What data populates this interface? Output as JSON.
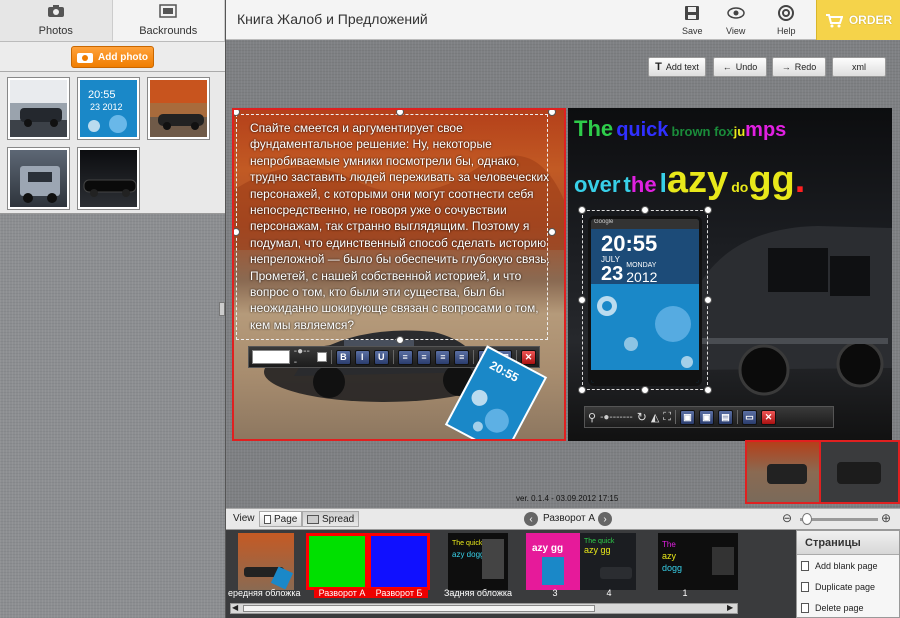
{
  "left_panel": {
    "tabs": [
      {
        "label": "Photos",
        "icon": "camera-icon"
      },
      {
        "label": "Backrounds",
        "icon": "background-icon"
      }
    ],
    "add_photo_label": "Add photo",
    "thumbnails": [
      "silver-car-photo",
      "blue-phone-photo",
      "canyon-car-photo",
      "rolls-royce-photo",
      "black-car-photo"
    ]
  },
  "header": {
    "title": "Книга Жалоб и Предложений",
    "save_label": "Save",
    "view_label": "View",
    "help_label": "Help",
    "order_label": "ORDER"
  },
  "toolbar": {
    "add_text": "Add text",
    "undo": "Undo",
    "redo": "Redo",
    "xml": "xml"
  },
  "left_page": {
    "text": "Спайте смеется и аргументирует свое фундаментальное решение: Ну, некоторые непробиваемые умники посмотрели бы, однако, трудно заставить людей переживать за человеческих персонажей, с которыми они могут соотнести себя непосредственно, не говоря уже о сочувствии персонажам, так странно выглядящим. Поэтому я подумал, что единственный способ сделать историю непреложной — было бы обеспечить глубокую связь. Прометей, с нашей собственной историей, и что вопрос о том, кто были эти существа, был бы неожиданно шокирующе связан с вопросами о том, кем мы являемся?",
    "mini_time": "20:55"
  },
  "right_page": {
    "headline_1": [
      "The",
      "quick",
      "brown fox",
      "ju",
      "mps"
    ],
    "headline_2": [
      "over",
      "t",
      "he",
      "l",
      "azy",
      "do",
      "gg",
      "."
    ],
    "phone_time": "20:55",
    "phone_month": "JULY",
    "phone_weekday": "MONDAY",
    "phone_day": "23",
    "phone_year": "2012",
    "phone_search": "Google"
  },
  "version": "ver. 0.1.4 - 03.09.2012 17:15",
  "viewbar": {
    "view_label": "View",
    "page_label": "Page",
    "spread_label": "Spread",
    "spread_name": "Разворот А"
  },
  "pages_strip": [
    {
      "label": "ередняя обложка"
    },
    {
      "label": "Разворот А"
    },
    {
      "label": "Разворот Б"
    },
    {
      "label": "Задняя обложка"
    },
    {
      "label": "3"
    },
    {
      "label": "4"
    },
    {
      "label": "1"
    }
  ],
  "pages_menu": {
    "title": "Страницы",
    "items": [
      "Add blank page",
      "Duplicate page",
      "Delete page"
    ]
  },
  "colors": {
    "order": "#f5d34a",
    "add_photo": "#f07d00",
    "selection": "#e02020",
    "spread_red": "#ff0000",
    "spread_green": "#00e000",
    "spread_blue": "#1010ff"
  }
}
